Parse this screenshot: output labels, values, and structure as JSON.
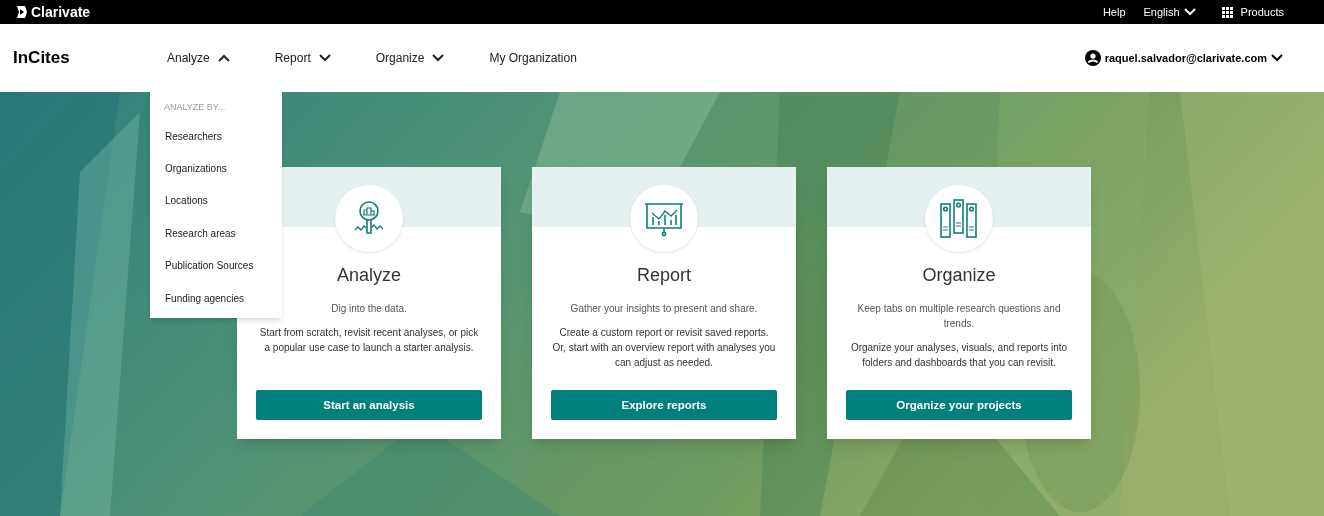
{
  "top_bar": {
    "brand": "Clarivate",
    "links": [
      {
        "label": "Help",
        "kind": "link"
      },
      {
        "label": "English",
        "kind": "dropdown"
      },
      {
        "label": "Products",
        "kind": "apps"
      }
    ]
  },
  "nav": {
    "product": "InCites",
    "items": [
      {
        "label": "Analyze",
        "kind": "dropdown",
        "expanded": true
      },
      {
        "label": "Report",
        "kind": "dropdown",
        "expanded": false
      },
      {
        "label": "Organize",
        "kind": "dropdown",
        "expanded": false
      },
      {
        "label": "My Organization",
        "kind": "link"
      }
    ],
    "user": "raquel.salvador@clarivate.com"
  },
  "analyze_menu": {
    "heading": "ANALYZE BY...",
    "items": [
      "Researchers",
      "Organizations",
      "Locations",
      "Research areas",
      "Publication Sources",
      "Funding agencies"
    ]
  },
  "cards": [
    {
      "kind": "analyze",
      "title": "Analyze",
      "summary": "Dig into the data.",
      "body": "Start from scratch, revisit recent analyses, or pick a popular use case to launch a starter analysis.",
      "button": "Start an analysis"
    },
    {
      "kind": "report",
      "title": "Report",
      "summary": "Gather your insights to present and share.",
      "body": "Create a custom report or revisit saved reports. Or, start with an overview report with analyses you can adjust as needed.",
      "button": "Explore reports"
    },
    {
      "kind": "organize",
      "title": "Organize",
      "summary": "Keep tabs on multiple research questions and trends.",
      "body": "Organize your analyses, visuals, and reports into folders and dashboards that you can revisit.",
      "button": "Organize your projects"
    }
  ]
}
